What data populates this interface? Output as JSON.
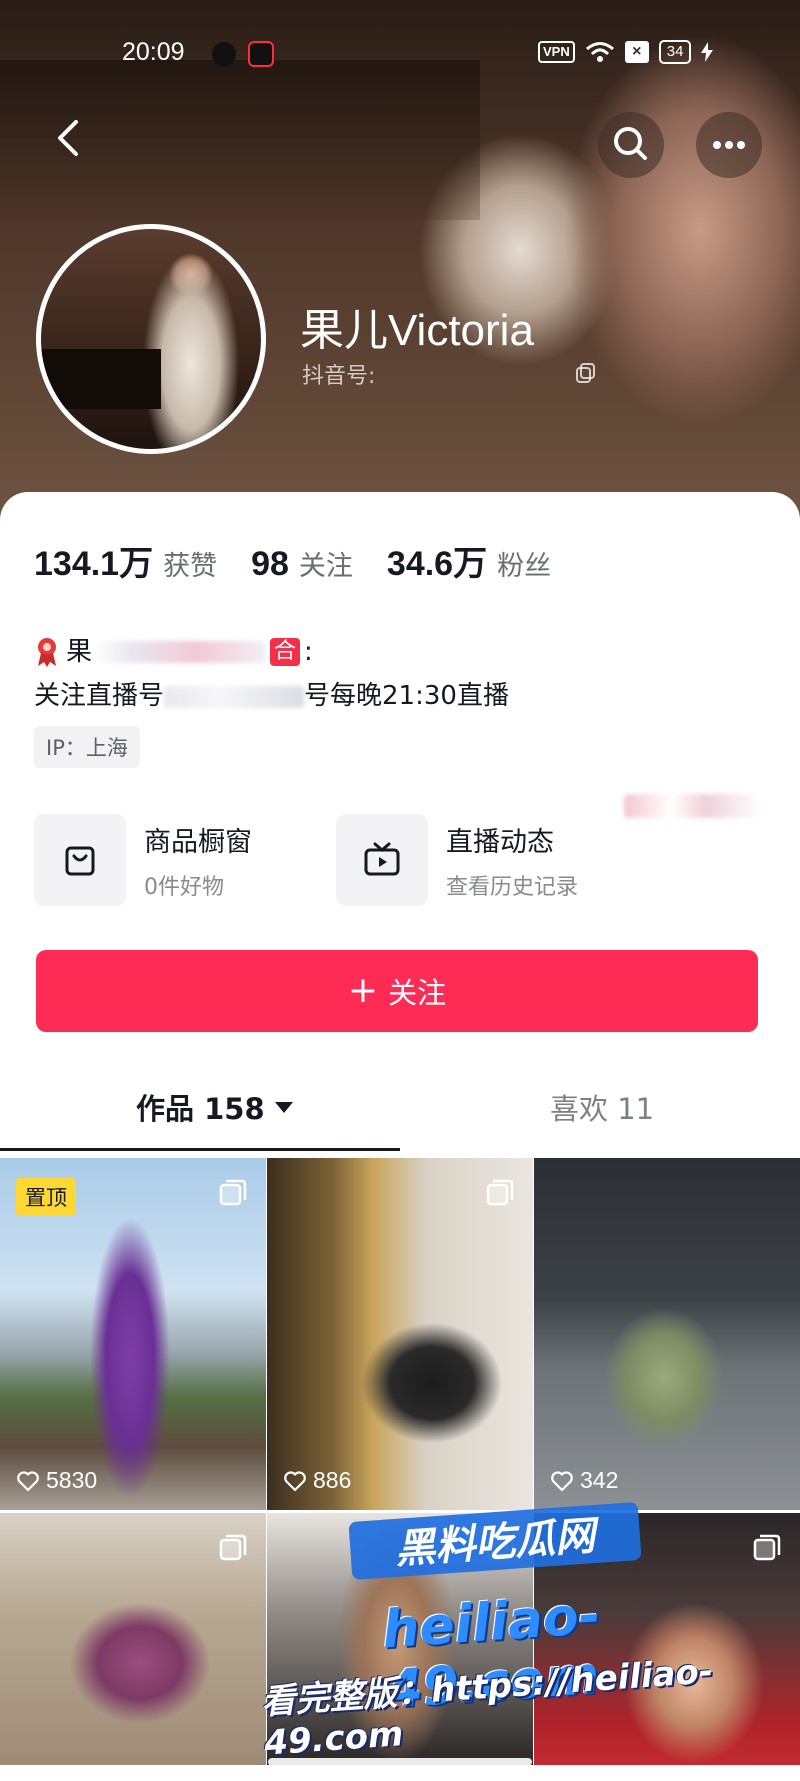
{
  "status_bar": {
    "time": "20:09",
    "vpn": "VPN",
    "battery": "34",
    "sim": "×"
  },
  "nav": {
    "back_icon": "chevron-left-icon",
    "search_icon": "search-icon",
    "more_icon": "more-horizontal-icon"
  },
  "profile": {
    "name": "果儿Victoria",
    "douyin_id_label": "抖音号:"
  },
  "stats": [
    {
      "value": "134.1万",
      "label": "获赞"
    },
    {
      "value": "98",
      "label": "关注"
    },
    {
      "value": "34.6万",
      "label": "粉丝"
    }
  ],
  "bio": {
    "line1_prefix": "果",
    "line1_chip": "合",
    "line1_suffix": ":",
    "line2_prefix": "关注直播号",
    "line2_suffix": "号每晚21:30直播",
    "ip": "IP：上海"
  },
  "features": {
    "shop": {
      "title": "商品橱窗",
      "subtitle": "0件好物"
    },
    "live": {
      "title": "直播动态",
      "subtitle": "查看历史记录"
    }
  },
  "follow_button": {
    "plus": "+",
    "label": "关注"
  },
  "tabs": {
    "works": "作品 158",
    "likes": "喜欢 11"
  },
  "grid": {
    "pin_label": "置顶",
    "items": [
      {
        "likes": "5830"
      },
      {
        "likes": "886"
      },
      {
        "likes": "342"
      }
    ]
  },
  "watermark": {
    "brand": "黑料吃瓜网",
    "domain": "heiliao-49.com",
    "url": "看完整版：https://heiliao-49.com"
  },
  "colors": {
    "accent": "#fe2c55",
    "pin_badge": "#fdd835",
    "text_primary": "#161823",
    "text_secondary": "#6b6d75"
  }
}
